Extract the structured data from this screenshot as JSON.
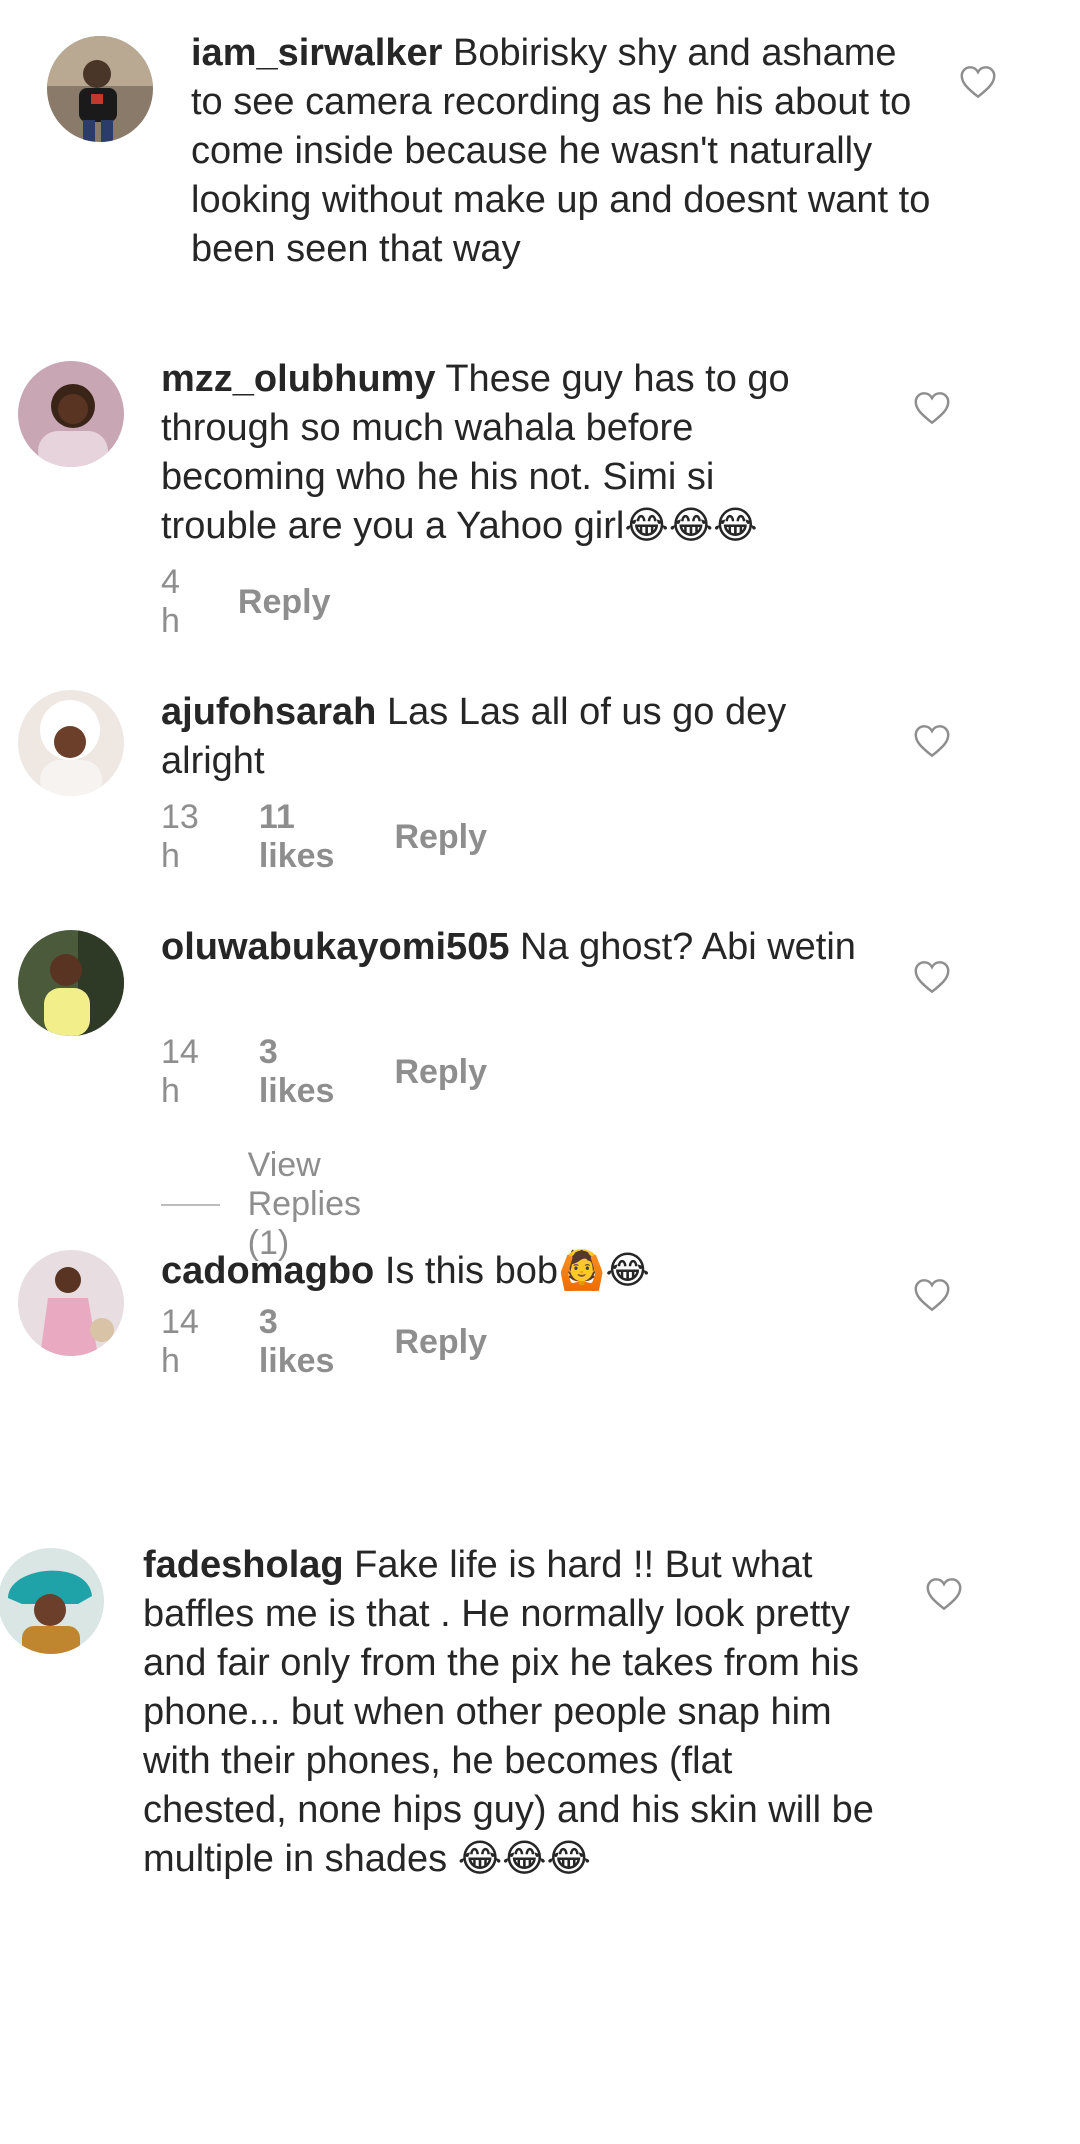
{
  "colors": {
    "text": "#262626",
    "meta": "#8e8e8e",
    "heart_stroke": "#8e8e8e"
  },
  "comments": [
    {
      "username": "iam_sirwalker",
      "text": "Bobirisky shy and ashame to see camera recording as he his about to come inside because he wasn't naturally looking without make up and doesnt want to been seen that way",
      "icon": "heart-outline-icon"
    },
    {
      "username": "mzz_olubhumy",
      "text": "These guy has to go through so much wahala before becoming who he his not.  Simi si trouble are you a Yahoo girl😂😂😂",
      "time": "4 h",
      "reply": "Reply",
      "icon": "heart-outline-icon"
    },
    {
      "username": "ajufohsarah",
      "text": "Las Las all of us go dey alright",
      "time": "13 h",
      "likes": "11 likes",
      "reply": "Reply",
      "icon": "heart-outline-icon"
    },
    {
      "username": "oluwabukayomi505",
      "text": "Na ghost? Abi wetin",
      "time": "14 h",
      "likes": "3 likes",
      "reply": "Reply",
      "view_replies": "View Replies (1)",
      "icon": "heart-outline-icon"
    },
    {
      "username": "cadomagbo",
      "text": "Is this bob🙆😂",
      "time": "14 h",
      "likes": "3 likes",
      "reply": "Reply",
      "icon": "heart-outline-icon"
    },
    {
      "username": "fadesholag",
      "text": "Fake life is hard !! But what baffles me is that . He normally look pretty and fair only from the pix he takes from his phone... but when other people snap him with their phones, he becomes (flat chested, none hips guy) and his skin will be multiple in shades 😂😂😂",
      "icon": "heart-outline-icon"
    }
  ]
}
